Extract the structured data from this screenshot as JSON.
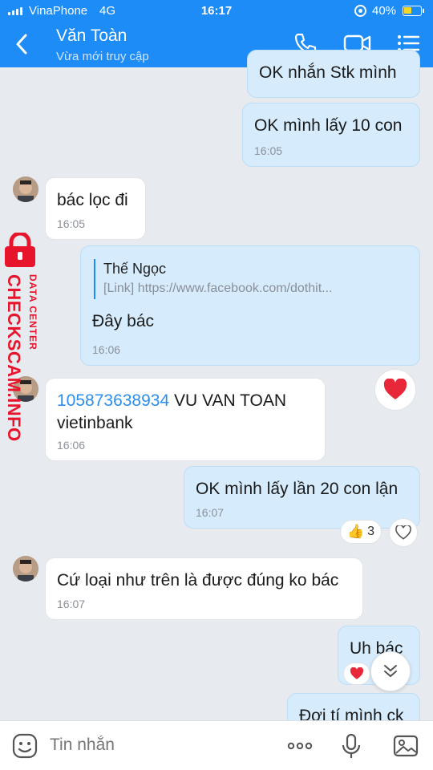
{
  "status": {
    "carrier": "VinaPhone",
    "network": "4G",
    "time": "16:17",
    "battery": "40%"
  },
  "header": {
    "name": "Văn Toàn",
    "subtitle": "Vừa mới truy cập"
  },
  "messages": [
    {
      "text": "OK nhắn Stk mình"
    },
    {
      "text": "OK mình lấy 10 con",
      "time": "16:05"
    },
    {
      "text": "bác lọc đi",
      "time": "16:05"
    },
    {
      "quote_name": "Thế Ngọc",
      "quote_link": "[Link] https://www.facebook.com/dothit...",
      "text": "Đây bác",
      "time": "16:06"
    },
    {
      "account": "105873638934",
      "text": " VU VAN TOAN",
      "line2": "vietinbank",
      "time": "16:06"
    },
    {
      "text": "OK mình lấy lần 20 con lận",
      "time": "16:07",
      "reaction_count": "3"
    },
    {
      "text": "Cứ loại như trên là được đúng ko bác",
      "time": "16:07"
    },
    {
      "text": "Uh bác"
    },
    {
      "text": "Đợi tí mình ck"
    }
  ],
  "watermark": {
    "brand": "CHECKSCAM.INFO",
    "tag": "DATA CENTER"
  },
  "composer": {
    "placeholder": "Tin nhắn"
  },
  "colors": {
    "header": "#1d8cf7",
    "bubble_me": "#d6ecfc",
    "background": "#e7eaef",
    "watermark": "#e8142b"
  }
}
